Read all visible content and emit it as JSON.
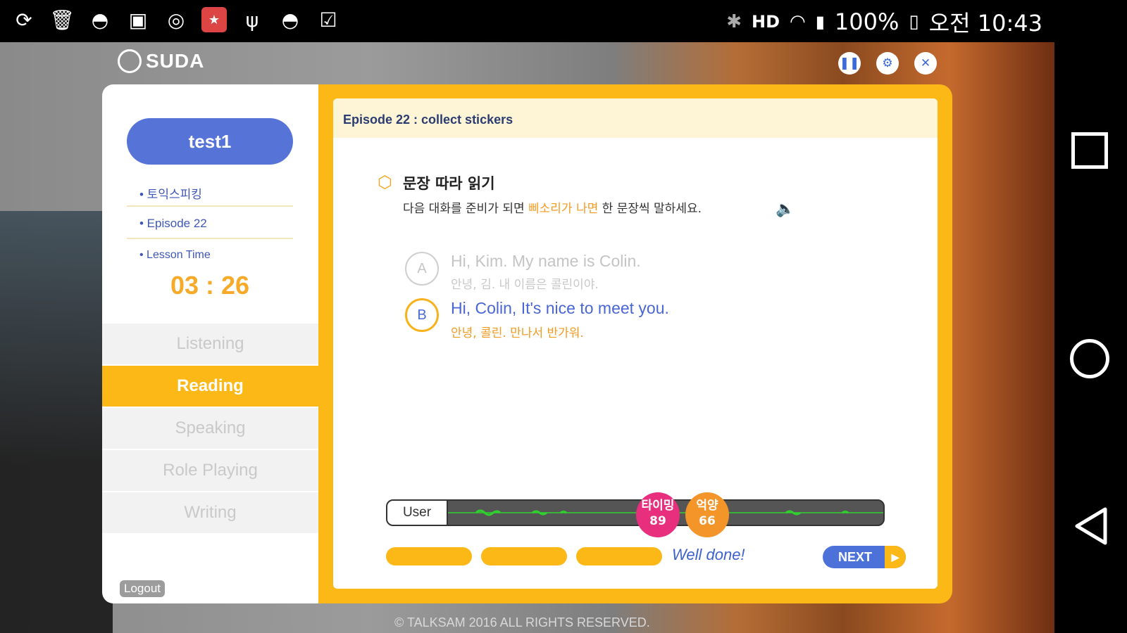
{
  "status_bar": {
    "left_icons": [
      "refresh-icon",
      "trash-icon",
      "android-icon",
      "image-icon",
      "chat-icon",
      "game-icon",
      "usb-icon",
      "android-icon",
      "clipboard-check-icon"
    ],
    "battery": "100%",
    "time": "오전 10:43",
    "hd_label": "HD"
  },
  "app": {
    "logo_text": "SUDA",
    "controls": [
      "pause-icon",
      "settings-icon",
      "close-icon"
    ]
  },
  "sidebar": {
    "user": "test1",
    "course": "• 토익스피킹",
    "episode": "• Episode 22",
    "lesson_time_label": "• Lesson Time",
    "lesson_time": "03 : 26",
    "menu": [
      {
        "label": "Listening",
        "active": false
      },
      {
        "label": "Reading",
        "active": true
      },
      {
        "label": "Speaking",
        "active": false
      },
      {
        "label": "Role Playing",
        "active": false
      },
      {
        "label": "Writing",
        "active": false
      }
    ],
    "logout": "Logout"
  },
  "content": {
    "episode_title": "Episode 22 : collect stickers",
    "task_title": "문장 따라 읽기",
    "task_desc_pre": "다음 대화를 준비가 되면 ",
    "task_desc_highlight": "삐소리가 나면",
    "task_desc_post": " 한 문장씩 말하세요.",
    "dialog": [
      {
        "badge": "A",
        "en": "Hi, Kim. My name is Colin.",
        "ko": "안녕, 김. 내 이름은 콜린이야."
      },
      {
        "badge": "B",
        "en": "Hi, Colin, It's nice to meet you.",
        "ko": "안녕, 콜린. 만나서 반가워."
      }
    ],
    "audio_label": "User",
    "scores": [
      {
        "label": "타이밍",
        "value": "89",
        "color": "#e72f7e"
      },
      {
        "label": "억양",
        "value": "66",
        "color": "#f39529"
      }
    ],
    "feedback": "Well done!",
    "next_label": "NEXT"
  },
  "footer": "© TALKSAM 2016 ALL RIGHTS RESERVED.",
  "colors": {
    "accent_yellow": "#fbb817",
    "accent_blue": "#5673d8",
    "pink": "#e72f7e",
    "orange": "#f39529"
  }
}
